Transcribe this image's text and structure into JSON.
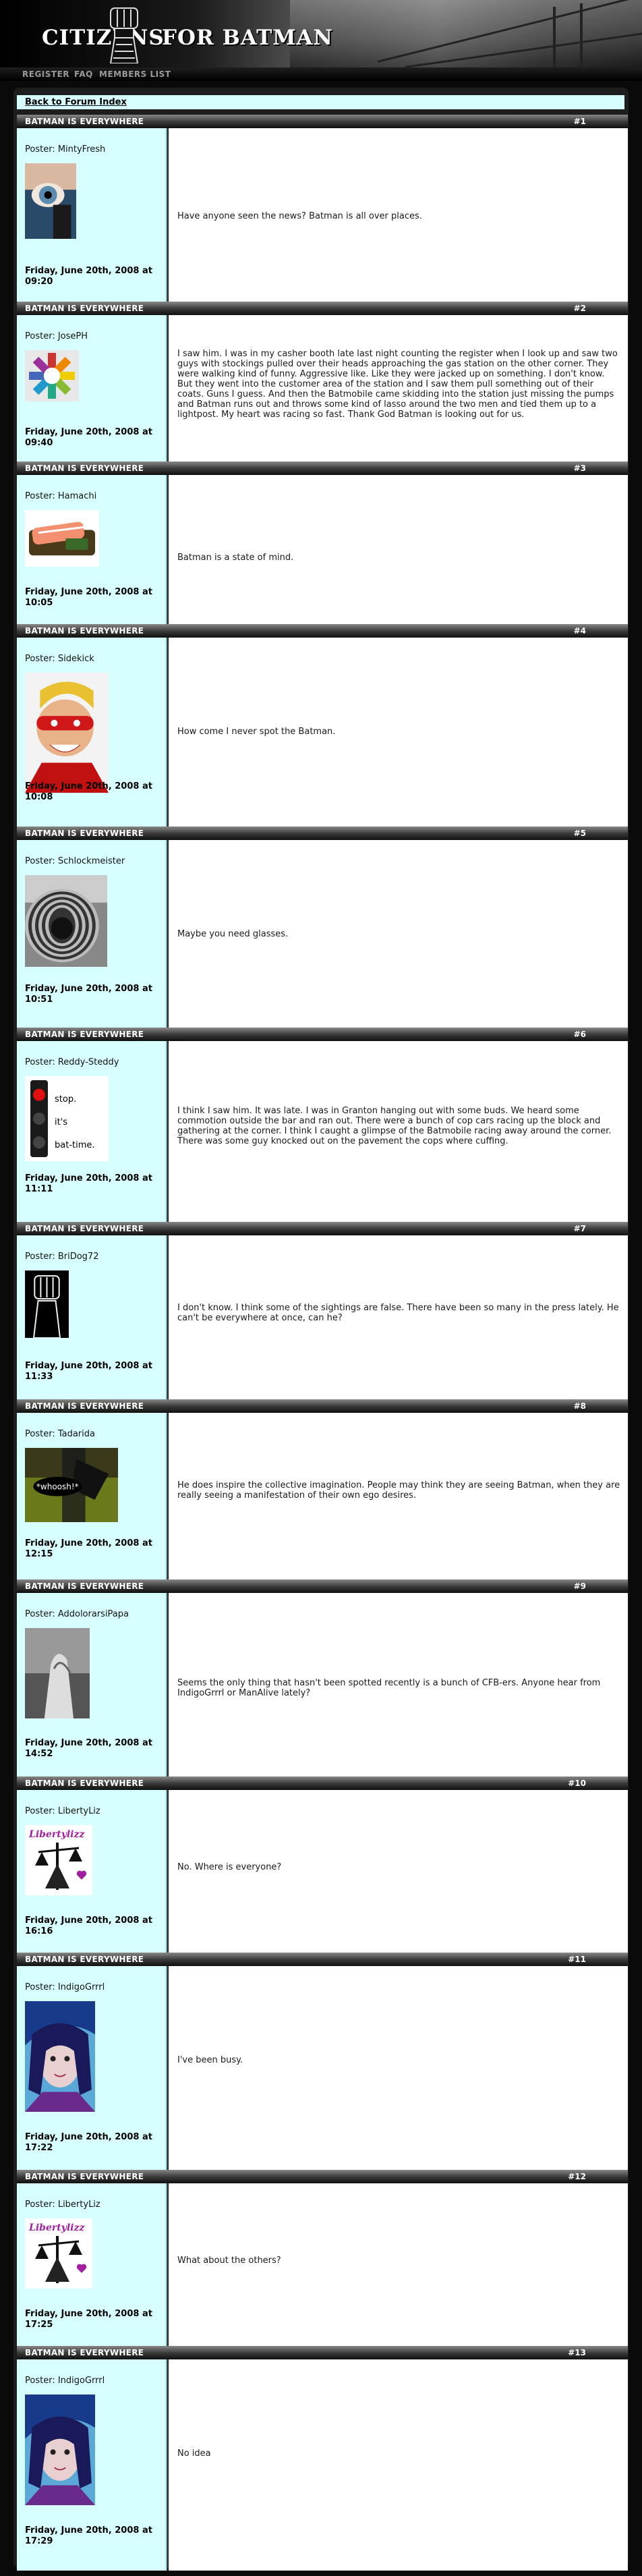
{
  "header": {
    "logo_left": "CITIZENS",
    "logo_right": "FOR BATMAN"
  },
  "nav": {
    "register": "REGISTER",
    "faq": "FAQ",
    "members": "MEMBERS LIST"
  },
  "back_link": "Back to Forum Index",
  "thread_title": "BATMAN IS EVERYWHERE",
  "colors": {
    "post_side_bg": "#d8ffff",
    "page_bg": "#0a0a0a",
    "frame_bg": "#1d1d1d"
  },
  "posts": [
    {
      "num": "#1",
      "poster": "Poster: MintyFresh",
      "date": "Friday, June 20th, 2008 at 09:20",
      "avatar_icon": "eye-avatar-icon",
      "message": "Have anyone seen the news? Batman is all over places."
    },
    {
      "num": "#2",
      "poster": "Poster: JosePH",
      "date": "Friday, June 20th, 2008 at 09:40",
      "avatar_icon": "color-wheel-avatar-icon",
      "message": "I saw him. I was in my casher booth late last night counting the register when I look up and saw two guys with stockings pulled over their heads approaching the gas station on the other corner. They were walking kind of funny. Aggressive like. Like they were jacked up on something. I don't know. But they went into the customer area of the station and I saw them pull something out of their coats. Guns I guess. And then the Batmobile came skidding into the station just missing the pumps and Batman runs out and throws some kind of lasso around the two men and tied them up to a lightpost. My heart was racing so fast. Thank God Batman is looking out for us."
    },
    {
      "num": "#3",
      "poster": "Poster: Hamachi",
      "date": "Friday, June 20th, 2008 at 10:05",
      "avatar_icon": "sushi-avatar-icon",
      "message": "Batman is a state of mind."
    },
    {
      "num": "#4",
      "poster": "Poster: Sidekick",
      "date": "Friday, June 20th, 2008 at 10:08",
      "avatar_icon": "masked-kid-avatar-icon",
      "message": "How come I never spot the Batman."
    },
    {
      "num": "#5",
      "poster": "Poster: Schlockmeister",
      "date": "Friday, June 20th, 2008 at 10:51",
      "avatar_icon": "lens-avatar-icon",
      "message": "Maybe you need glasses."
    },
    {
      "num": "#6",
      "poster": "Poster: Reddy-Steddy",
      "date": "Friday, June 20th, 2008 at 11:11",
      "avatar_icon": "traffic-light-avatar-icon",
      "avatar_text": [
        "stop.",
        "it's",
        "bat-time."
      ],
      "message": "I think I saw him. It was late. I was in Granton hanging out with some buds. We heard some commotion outside the bar and ran out. There were a bunch of cop cars racing up the block and gathering at the corner. I think I caught a glimpse of the Batmobile racing away around the corner. There was some guy knocked out on the pavement the cops where cuffing."
    },
    {
      "num": "#7",
      "poster": "Poster: BriDog72",
      "date": "Friday, June 20th, 2008 at 11:33",
      "avatar_icon": "fist-avatar-icon",
      "message": "I don't know. I think some of the sightings are false. There have been so many in the press lately. He can't be everywhere at once, can he?"
    },
    {
      "num": "#8",
      "poster": "Poster: Tadarida",
      "date": "Friday, June 20th, 2008 at 12:15",
      "avatar_icon": "bat-avatar-icon",
      "avatar_text": [
        "*whoosh!*"
      ],
      "message": "He does inspire the collective imagination. People may think they are seeing Batman, when they are really seeing a manifestation of their own ego desires."
    },
    {
      "num": "#9",
      "poster": "Poster: AddolorarsiPapa",
      "date": "Friday, June 20th, 2008 at 14:52",
      "avatar_icon": "hands-avatar-icon",
      "message": "Seems the only thing that hasn't been spotted recently is a bunch of CFB-ers. Anyone hear from IndigoGrrrl or ManAlive lately?"
    },
    {
      "num": "#10",
      "poster": "Poster: LibertyLiz",
      "date": "Friday, June 20th, 2008 at 16:16",
      "avatar_icon": "liberty-avatar-icon",
      "avatar_text": [
        "Libertylizz"
      ],
      "message": "No. Where is everyone?"
    },
    {
      "num": "#11",
      "poster": "Poster: IndigoGrrrl",
      "date": "Friday, June 20th, 2008 at 17:22",
      "avatar_icon": "girl-avatar-icon",
      "message": "I've been busy."
    },
    {
      "num": "#12",
      "poster": "Poster: LibertyLiz",
      "date": "Friday, June 20th, 2008 at 17:25",
      "avatar_icon": "liberty-avatar-icon",
      "avatar_text": [
        "Libertylizz"
      ],
      "message": "What about the others?"
    },
    {
      "num": "#13",
      "poster": "Poster: IndigoGrrrl",
      "date": "Friday, June 20th, 2008 at 17:29",
      "avatar_icon": "girl-avatar-icon",
      "message": "No idea"
    }
  ]
}
